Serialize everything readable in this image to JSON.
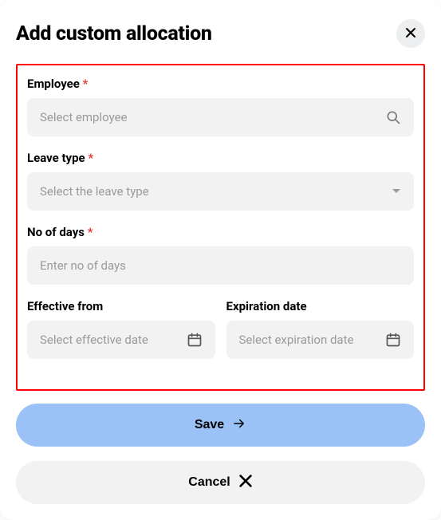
{
  "dialog": {
    "title": "Add custom allocation"
  },
  "fields": {
    "employee": {
      "label": "Employee",
      "required_mark": "*",
      "placeholder": "Select employee"
    },
    "leave_type": {
      "label": "Leave type",
      "required_mark": "*",
      "placeholder": "Select the leave type"
    },
    "no_of_days": {
      "label": "No of days",
      "required_mark": "*",
      "placeholder": "Enter no of days"
    },
    "effective_from": {
      "label": "Effective from",
      "placeholder": "Select effective date"
    },
    "expiration_date": {
      "label": "Expiration date",
      "placeholder": "Select expiration date"
    }
  },
  "buttons": {
    "save": "Save",
    "cancel": "Cancel"
  }
}
